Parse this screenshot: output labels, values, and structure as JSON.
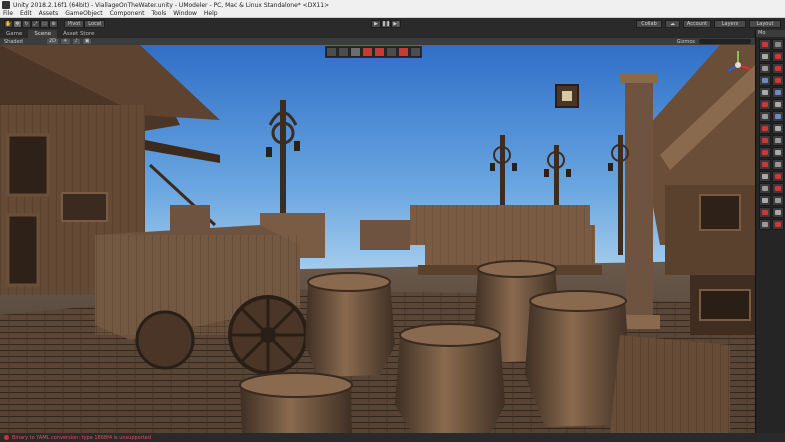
{
  "window": {
    "title": "Unity 2018.2.16f1 (64bit) - ViallageOnTheWater.unity - UModeler - PC, Mac & Linux Standalone* <DX11>"
  },
  "menu": [
    "File",
    "Edit",
    "Assets",
    "GameObject",
    "Component",
    "Tools",
    "Window",
    "Help"
  ],
  "toolbar": {
    "pivot": "Pivot",
    "local": "Local",
    "play_icon": "play-icon",
    "pause_icon": "pause-icon",
    "step_icon": "step-icon",
    "collab": "Collab",
    "account": "Account",
    "layers": "Layers",
    "layout": "Layout"
  },
  "tabs": [
    "Game",
    "Scene",
    "Asset Store"
  ],
  "scenebar": {
    "shading": "Shaded",
    "mode_2d": "2D",
    "gizmos": "Gizmos"
  },
  "side_panel": {
    "tab": "Mo"
  },
  "status": {
    "message": "Binary to YAML conversion: type 1868f4 is unsupported"
  },
  "colors": {
    "sky_top": "#2f6fc7",
    "sky_bottom": "#bcdcf2",
    "wood_dark": "#4a3526",
    "wood_mid": "#7c5b40",
    "wood_light": "#a88560",
    "accent_red": "#c83a32",
    "error_red": "#e05050"
  }
}
